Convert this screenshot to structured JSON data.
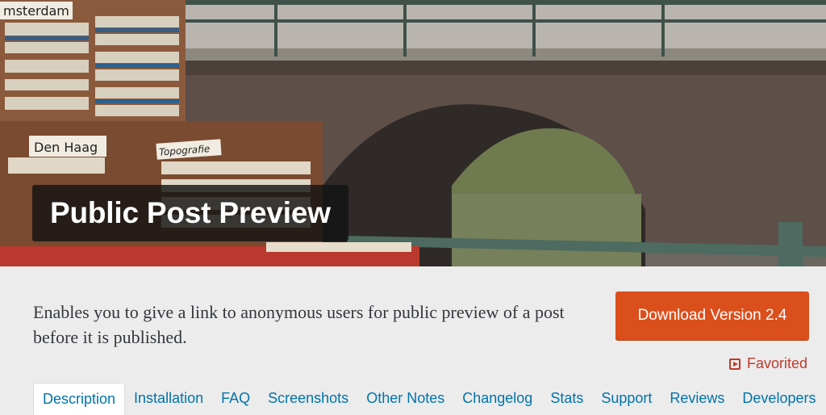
{
  "banner": {
    "title": "Public Post Preview",
    "signs": {
      "amsterdam": "msterdam",
      "den_haag": "Den Haag",
      "topografie": "Topografie"
    }
  },
  "plugin": {
    "description": "Enables you to give a link to anonymous users for public preview of a post before it is published.",
    "download_label": "Download Version 2.4",
    "favorited_label": "Favorited"
  },
  "tabs": [
    {
      "label": "Description",
      "active": true
    },
    {
      "label": "Installation",
      "active": false
    },
    {
      "label": "FAQ",
      "active": false
    },
    {
      "label": "Screenshots",
      "active": false
    },
    {
      "label": "Other Notes",
      "active": false
    },
    {
      "label": "Changelog",
      "active": false
    },
    {
      "label": "Stats",
      "active": false
    },
    {
      "label": "Support",
      "active": false
    },
    {
      "label": "Reviews",
      "active": false
    },
    {
      "label": "Developers",
      "active": false
    }
  ],
  "colors": {
    "accent": "#db4f1c",
    "link": "#0073aa",
    "favorite": "#c0392b"
  }
}
